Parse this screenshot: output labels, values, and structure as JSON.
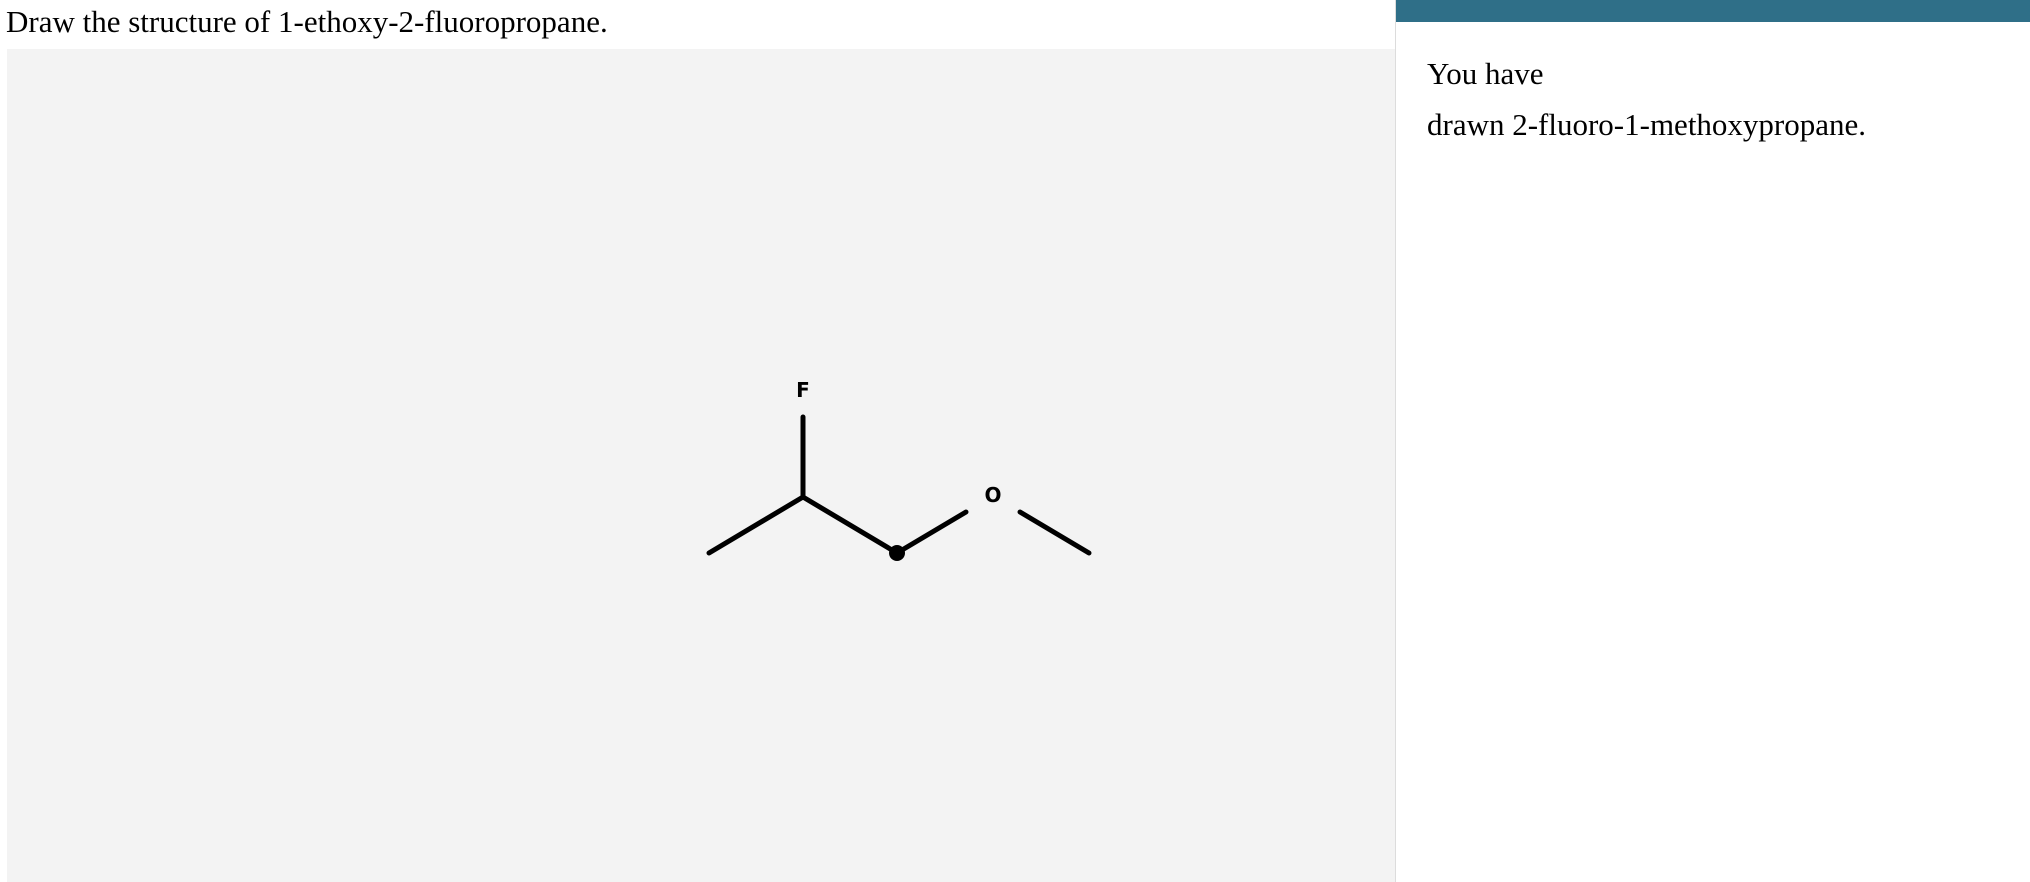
{
  "question": {
    "text": "Draw the structure of 1-ethoxy-2-fluoropropane."
  },
  "sketch": {
    "atoms": {
      "fluorine": "F",
      "oxygen": "O"
    }
  },
  "feedback": {
    "line1": "You have",
    "line2": "drawn 2-fluoro-1-methoxypropane."
  },
  "colors": {
    "header_bar": "#2f6f88",
    "canvas_background": "#f3f3f3",
    "bond_color": "#000000"
  }
}
